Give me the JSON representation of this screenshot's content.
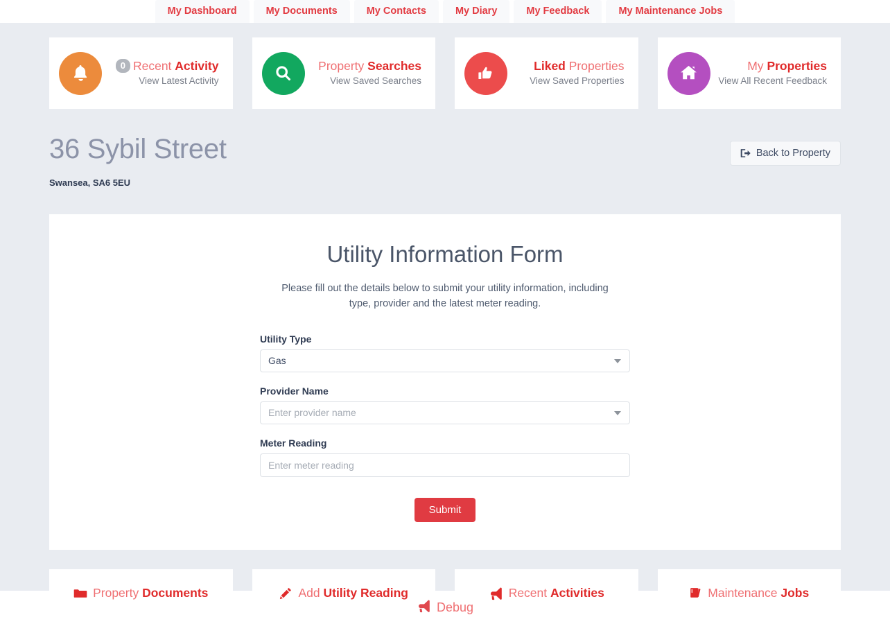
{
  "nav": {
    "tabs": [
      {
        "label": "My Dashboard",
        "name": "tab-my-dashboard"
      },
      {
        "label": "My Documents",
        "name": "tab-my-documents"
      },
      {
        "label": "My Contacts",
        "name": "tab-my-contacts"
      },
      {
        "label": "My Diary",
        "name": "tab-my-diary"
      },
      {
        "label": "My Feedback",
        "name": "tab-my-feedback"
      },
      {
        "label": "My Maintenance Jobs",
        "name": "tab-my-maintenance-jobs"
      }
    ]
  },
  "stat_cards": [
    {
      "badge": "0",
      "title_light": "Recent ",
      "title_bold": "Activity",
      "subtitle": "View Latest Activity",
      "icon": "bell-icon",
      "circle_color": "#ec8b3c"
    },
    {
      "badge": "",
      "title_light": "Property ",
      "title_bold": "Searches",
      "subtitle": "View Saved Searches",
      "icon": "search-icon",
      "circle_color": "#12a85f"
    },
    {
      "badge": "",
      "title_light": "",
      "title_bold": "Liked",
      "title_after": " Properties",
      "subtitle": "View Saved Properties",
      "icon": "thumbs-up-icon",
      "circle_color": "#ec4c4c"
    },
    {
      "badge": "",
      "title_light": "My ",
      "title_bold": "Properties",
      "subtitle": "View All Recent Feedback",
      "icon": "home-icon",
      "circle_color": "#b44fc0"
    }
  ],
  "property": {
    "title": "36 Sybil Street",
    "address": "Swansea, SA6 5EU",
    "back_button": "Back to Property",
    "back_icon": "sign-out-icon"
  },
  "form": {
    "title": "Utility Information Form",
    "description": "Please fill out the details below to submit your utility information, including type, provider and the latest meter reading.",
    "fields": [
      {
        "label": "Utility Type",
        "type": "select",
        "value": "Gas",
        "placeholder": "",
        "name": "utility-type-select"
      },
      {
        "label": "Provider Name",
        "type": "select",
        "value": "",
        "placeholder": "Enter provider name",
        "name": "provider-name-select"
      },
      {
        "label": "Meter Reading",
        "type": "input",
        "value": "",
        "placeholder": "Enter meter reading",
        "name": "meter-reading-input"
      }
    ],
    "submit_label": "Submit"
  },
  "action_cards": [
    {
      "light": "Property ",
      "bold": "Documents",
      "icon": "folder-icon",
      "name": "action-property-documents"
    },
    {
      "light": "Add ",
      "bold": "Utility Reading",
      "icon": "pencil-icon",
      "name": "action-add-utility-reading"
    },
    {
      "light": "Recent ",
      "bold": "Activities",
      "icon": "bullhorn-icon",
      "name": "action-recent-activities"
    },
    {
      "light": "Maintenance ",
      "bold": "Jobs",
      "icon": "book-icon",
      "name": "action-maintenance-jobs"
    }
  ],
  "footer": {
    "debug_label": "Debug",
    "debug_icon": "bullhorn-icon"
  },
  "colors": {
    "accent_red": "#e03b42",
    "light_red": "#ef6f72",
    "page_bg": "#e9ecf1",
    "title_gray": "#8c93a8"
  }
}
